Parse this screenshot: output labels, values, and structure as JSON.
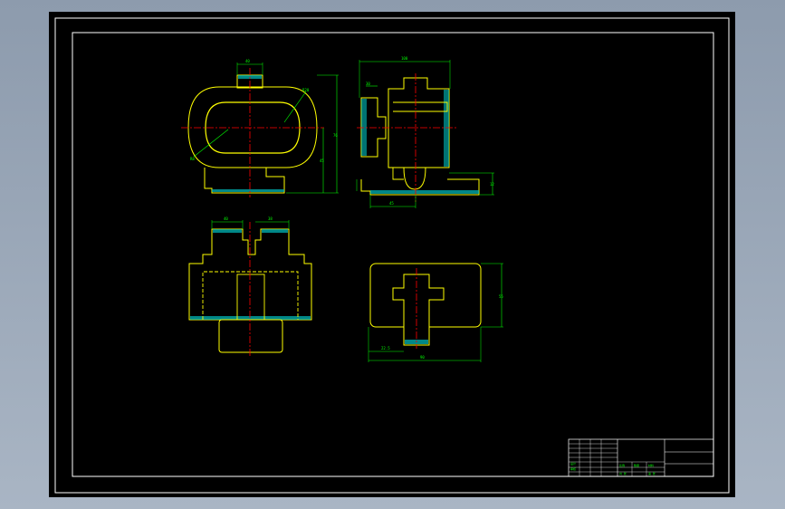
{
  "colors": {
    "background": "#000000",
    "frame": "#ffffff",
    "outline": "#ffff00",
    "centerline": "#ff0000",
    "dimension": "#00ff00",
    "hatch": "#00c0c0",
    "desktop": "#9aa7b8"
  },
  "dimensions": {
    "top_view_width": "40",
    "top_view_height": "76",
    "top_view_inner": "45",
    "top_view_radius": "R20",
    "top_view_r2": "R8",
    "side_view_width": "100",
    "side_view_left": "30",
    "side_view_base": "45",
    "side_view_base_h": "12",
    "front_left": "40",
    "front_right": "38",
    "bottom_height": "55",
    "bottom_small": "22.5",
    "bottom_width": "90"
  },
  "title_block": {
    "label_1": "设计",
    "label_2": "审核",
    "label_3": "比例",
    "label_4": "数量",
    "label_5": "材料",
    "label_6": "共 张",
    "label_7": "第 张"
  }
}
